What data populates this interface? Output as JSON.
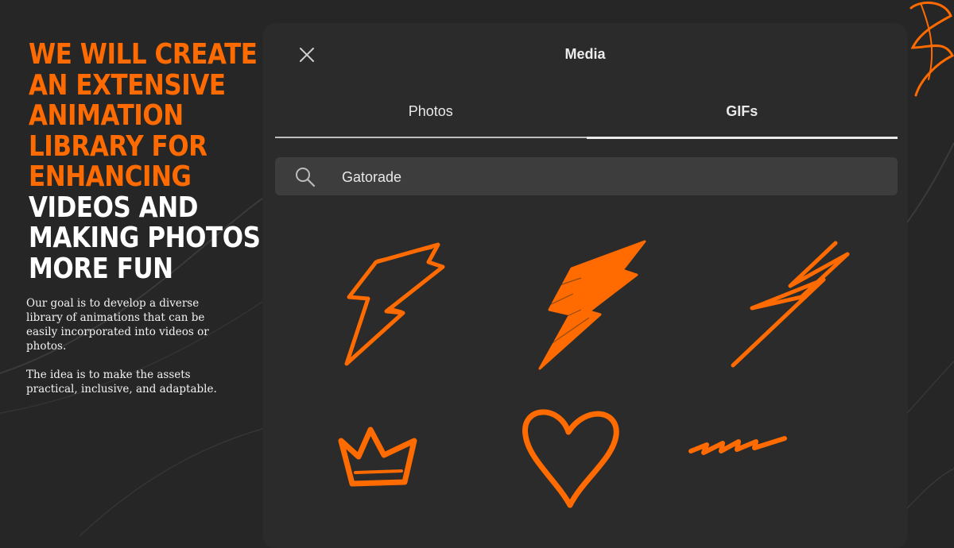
{
  "headline": {
    "orange_lines": [
      "WE WILL CREATE",
      "AN EXTENSIVE",
      "ANIMATION",
      "LIBRARY FOR",
      "ENHANCING"
    ],
    "white_lines": [
      "VIDEOS AND",
      "MAKING PHOTOS",
      "MORE FUN"
    ]
  },
  "body": {
    "paragraph_1": "Our goal is to develop a diverse library of animations that can be easily incorporated into videos or photos.",
    "paragraph_2": "The idea is to make the assets practical, inclusive, and adaptable."
  },
  "modal": {
    "title": "Media",
    "close_icon": "close-icon",
    "tabs": [
      {
        "label": "Photos",
        "active": false
      },
      {
        "label": "GIFs",
        "active": true
      }
    ],
    "search": {
      "icon": "search-icon",
      "value": "Gatorade"
    },
    "gifs": [
      {
        "icon": "lightning-bolt-outline-icon"
      },
      {
        "icon": "lightning-bolt-filled-icon"
      },
      {
        "icon": "lightning-zigzag-icon"
      },
      {
        "icon": "crown-icon"
      },
      {
        "icon": "heart-icon"
      },
      {
        "icon": "squiggle-icon"
      }
    ]
  },
  "colors": {
    "accent": "#ff6b00",
    "background": "#262626",
    "modal": "#2b2b2b",
    "search_bar": "#3d3d3d",
    "text": "#ececec"
  }
}
